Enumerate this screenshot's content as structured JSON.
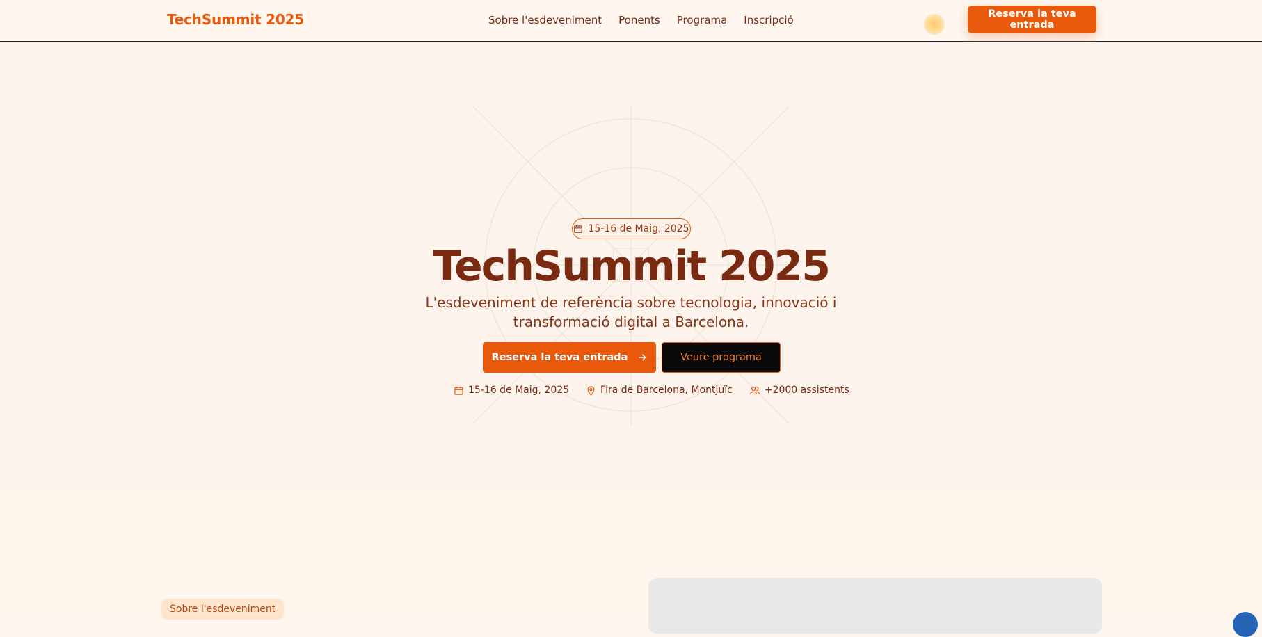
{
  "nav": {
    "brand": "TechSummit 2025",
    "links": [
      "Sobre l'esdeveniment",
      "Ponents",
      "Programa",
      "Inscripció"
    ],
    "cta": "Reserva la teva entrada"
  },
  "hero": {
    "date_badge": "15-16 de Maig, 2025",
    "title": "TechSummit 2025",
    "subtitle": "L'esdeveniment de referència sobre tecnologia, innovació i transformació digital a Barcelona.",
    "primary_button": "Reserva la teva entrada",
    "secondary_button": "Veure programa",
    "meta": {
      "date": "15-16 de Maig, 2025",
      "location": "Fira de Barcelona, Montjuïc",
      "attendees": "+2000 assistents"
    }
  },
  "about": {
    "tag": "Sobre l'esdeveniment"
  },
  "colors": {
    "accent": "#e8590c",
    "title": "#7a2a10",
    "background": "#fbf3ec"
  }
}
